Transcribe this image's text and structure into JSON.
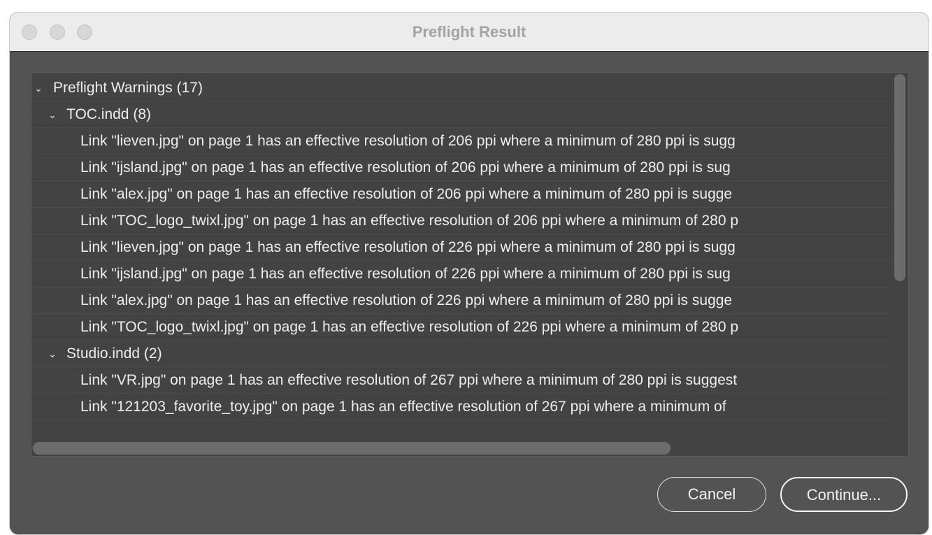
{
  "window": {
    "title": "Preflight Result"
  },
  "tree": {
    "root": {
      "label": "Preflight Warnings (17)",
      "expanded": true
    },
    "groups": [
      {
        "label": "TOC.indd (8)",
        "expanded": true,
        "items": [
          "Link \"lieven.jpg\" on page 1 has an effective resolution of 206 ppi where a minimum of 280 ppi is sugg",
          "Link \"ijsland.jpg\" on page 1 has an effective resolution of 206 ppi where a minimum of 280 ppi is sug",
          "Link \"alex.jpg\" on page 1 has an effective resolution of 206 ppi where a minimum of 280 ppi is sugge",
          "Link \"TOC_logo_twixl.jpg\" on page 1 has an effective resolution of 206 ppi where a minimum of 280 p",
          "Link \"lieven.jpg\" on page 1 has an effective resolution of 226 ppi where a minimum of 280 ppi is sugg",
          "Link \"ijsland.jpg\" on page 1 has an effective resolution of 226 ppi where a minimum of 280 ppi is sug",
          "Link \"alex.jpg\" on page 1 has an effective resolution of 226 ppi where a minimum of 280 ppi is sugge",
          "Link \"TOC_logo_twixl.jpg\" on page 1 has an effective resolution of 226 ppi where a minimum of 280 p"
        ]
      },
      {
        "label": "Studio.indd (2)",
        "expanded": true,
        "items": [
          "Link \"VR.jpg\" on page 1 has an effective resolution of 267 ppi where a minimum of 280 ppi is suggest",
          "Link \"121203_favorite_toy.jpg\" on page 1 has an effective resolution of 267 ppi where a minimum of"
        ]
      }
    ]
  },
  "scroll": {
    "vertical_thumb_fraction": 0.57,
    "horizontal_thumb_fraction": 0.74
  },
  "buttons": {
    "cancel": "Cancel",
    "continue": "Continue..."
  },
  "icons": {
    "expanded": "chevron-down-icon"
  },
  "colors": {
    "window_bg": "#535353",
    "panel_bg": "#434343",
    "titlebar_bg": "#ececec",
    "text": "#ededed"
  }
}
